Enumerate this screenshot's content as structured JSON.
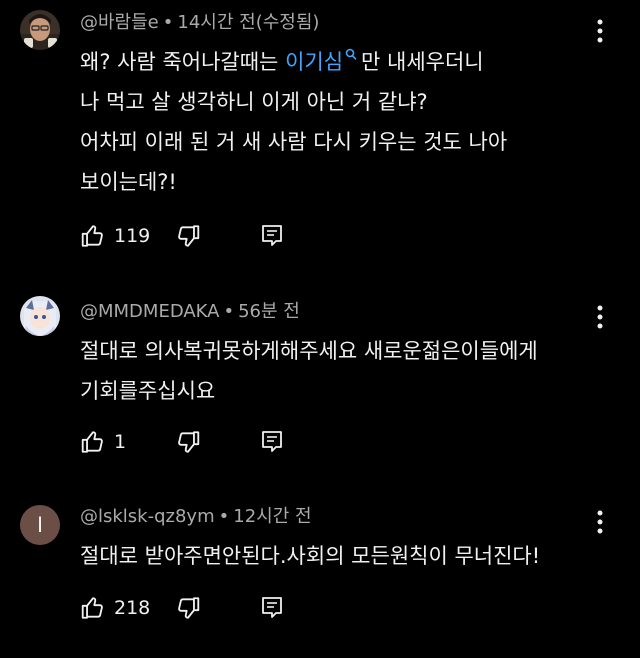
{
  "comments": [
    {
      "author": "@바람들e",
      "time": "14시간 전(수정됨)",
      "lines": [
        {
          "before": "왜? 사람 죽어나갈때는 ",
          "link": "이기심",
          "after": "만 내세우더니"
        },
        {
          "text": "나 먹고 살 생각하니 이게 아닌 거 같냐?"
        },
        {
          "text": "어차피 이래 된 거 새 사람 다시 키우는 것도 나아"
        },
        {
          "text": "보이는데?!"
        }
      ],
      "likes": "119"
    },
    {
      "author": "@MMDMEDAKA",
      "time": "56분 전",
      "lines": [
        {
          "text": "절대로 의사복귀못하게해주세요  새로운젊은이들에게"
        },
        {
          "text": "기회를주십시요"
        }
      ],
      "likes": "1"
    },
    {
      "author": "@lsklsk-qz8ym",
      "time": "12시간 전",
      "avatar_letter": "l",
      "lines": [
        {
          "text": "절대로 받아주면안된다.사회의 모든원칙이 무너진다!"
        }
      ],
      "likes": "218"
    }
  ],
  "colors": {
    "background": "#000000",
    "text": "#f1f1f1",
    "meta": "#aaaaaa",
    "link": "#3ea6ff",
    "avatar3": "#6b4f47"
  },
  "icons": {
    "like": "thumbs-up-icon",
    "dislike": "thumbs-down-icon",
    "reply": "reply-icon",
    "menu": "more-vertical-icon",
    "search": "search-icon"
  }
}
